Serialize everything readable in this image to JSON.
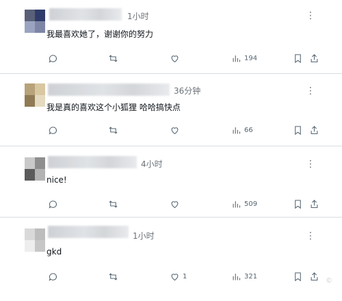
{
  "replies": [
    {
      "time": "1小时",
      "text": "我最喜欢她了，谢谢你的努力",
      "actions": {
        "reply_count": "",
        "repost_count": "",
        "like_count": "",
        "views": "194"
      },
      "avatar_colors": [
        "#5a6077",
        "#2f3c6b",
        "#9aa3c0",
        "#7d86a6"
      ]
    },
    {
      "time": "36分钟",
      "text": "我是真的喜欢这个小狐狸 哈哈搞快点",
      "actions": {
        "reply_count": "",
        "repost_count": "",
        "like_count": "",
        "views": "66"
      },
      "avatar_colors": [
        "#b7a27a",
        "#d8c7a1",
        "#8f7a55",
        "#e5dac0"
      ]
    },
    {
      "time": "4小时",
      "text": "nice!",
      "actions": {
        "reply_count": "",
        "repost_count": "",
        "like_count": "",
        "views": "509"
      },
      "avatar_colors": [
        "#c9c9c9",
        "#8e8e8e",
        "#5b5b5b",
        "#b3b3b3"
      ]
    },
    {
      "time": "1小时",
      "text": "gkd",
      "actions": {
        "reply_count": "",
        "repost_count": "",
        "like_count": "1",
        "views": "321"
      },
      "avatar_colors": [
        "#d9d9d9",
        "#bdbdbd",
        "#eeeeee",
        "#c7c7c7"
      ]
    }
  ],
  "more_glyph": "⋮",
  "watermark": "© "
}
